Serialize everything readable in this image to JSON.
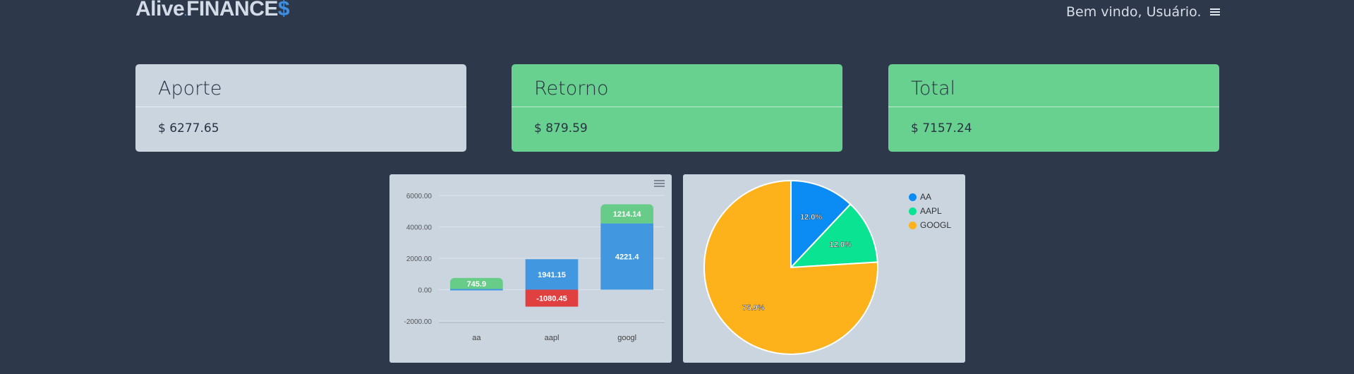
{
  "header": {
    "brand_alive": "Alive",
    "brand_dot": ".",
    "brand_finance": "FINANCE",
    "brand_dollar": "$",
    "welcome": "Bem vindo, Usuário."
  },
  "cards": {
    "aporte": {
      "title": "Aporte",
      "value": "$ 6277.65"
    },
    "retorno": {
      "title": "Retorno",
      "value": "$ 879.59"
    },
    "total": {
      "title": "Total",
      "value": "$ 7157.24"
    }
  },
  "colors": {
    "aporte": "#4198e0",
    "retorno_pos": "#66cc88",
    "retorno_neg": "#e04040",
    "pie": [
      "#0b8cf5",
      "#0ae392",
      "#fdb11a"
    ]
  },
  "chart_data": [
    {
      "type": "bar",
      "stacked": true,
      "categories": [
        "aa",
        "aapl",
        "googl"
      ],
      "series": [
        {
          "values": [
            0,
            1941.15,
            4221.4
          ],
          "labels": [
            "",
            "1941.15",
            "4221.4"
          ]
        },
        {
          "values": [
            745.9,
            -1080.45,
            1214.14
          ],
          "labels": [
            "745.9",
            "-1080.45",
            "1214.14"
          ]
        }
      ],
      "yticks": [
        "6000.00",
        "4000.00",
        "2000.00",
        "0.00",
        "-2000.00"
      ],
      "ylim": [
        -2000,
        6000
      ],
      "grid": true
    },
    {
      "type": "pie",
      "labels": [
        "AA",
        "AAPL",
        "GOOGL"
      ],
      "values": [
        12.0,
        12.0,
        75.9
      ],
      "value_labels": [
        "12.0%",
        "12.0%",
        "75.9%"
      ],
      "legend": "top-right"
    }
  ]
}
